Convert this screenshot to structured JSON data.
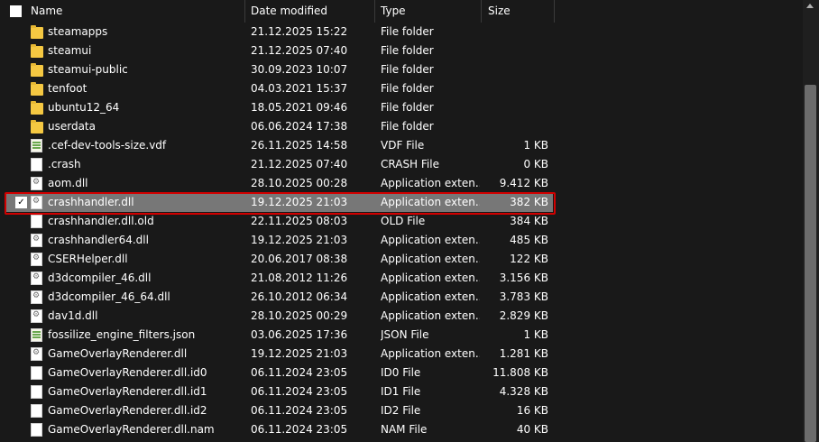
{
  "columns": {
    "name": "Name",
    "date": "Date modified",
    "type": "Type",
    "size": "Size"
  },
  "files": [
    {
      "name": "steamapps",
      "date": "21.12.2025 15:22",
      "type": "File folder",
      "size": "",
      "icon": "folder-icon"
    },
    {
      "name": "steamui",
      "date": "21.12.2025 07:40",
      "type": "File folder",
      "size": "",
      "icon": "folder-icon"
    },
    {
      "name": "steamui-public",
      "date": "30.09.2023 10:07",
      "type": "File folder",
      "size": "",
      "icon": "folder-icon"
    },
    {
      "name": "tenfoot",
      "date": "04.03.2021 15:37",
      "type": "File folder",
      "size": "",
      "icon": "folder-icon"
    },
    {
      "name": "ubuntu12_64",
      "date": "18.05.2021 09:46",
      "type": "File folder",
      "size": "",
      "icon": "folder-icon"
    },
    {
      "name": "userdata",
      "date": "06.06.2024 17:38",
      "type": "File folder",
      "size": "",
      "icon": "folder-icon"
    },
    {
      "name": ".cef-dev-tools-size.vdf",
      "date": "26.11.2025 14:58",
      "type": "VDF File",
      "size": "1 KB",
      "icon": "vdf-file-icon"
    },
    {
      "name": ".crash",
      "date": "21.12.2025 07:40",
      "type": "CRASH File",
      "size": "0 KB",
      "icon": "file-icon"
    },
    {
      "name": "aom.dll",
      "date": "28.10.2025 00:28",
      "type": "Application exten...",
      "size": "9.412 KB",
      "icon": "dll-file-icon"
    },
    {
      "name": "crashhandler.dll",
      "date": "19.12.2025 21:03",
      "type": "Application exten...",
      "size": "382 KB",
      "icon": "dll-file-icon",
      "selected": true
    },
    {
      "name": "crashhandler.dll.old",
      "date": "22.11.2025 08:03",
      "type": "OLD File",
      "size": "384 KB",
      "icon": "file-icon"
    },
    {
      "name": "crashhandler64.dll",
      "date": "19.12.2025 21:03",
      "type": "Application exten...",
      "size": "485 KB",
      "icon": "dll-file-icon"
    },
    {
      "name": "CSERHelper.dll",
      "date": "20.06.2017 08:38",
      "type": "Application exten...",
      "size": "122 KB",
      "icon": "dll-file-icon"
    },
    {
      "name": "d3dcompiler_46.dll",
      "date": "21.08.2012 11:26",
      "type": "Application exten...",
      "size": "3.156 KB",
      "icon": "dll-file-icon"
    },
    {
      "name": "d3dcompiler_46_64.dll",
      "date": "26.10.2012 06:34",
      "type": "Application exten...",
      "size": "3.783 KB",
      "icon": "dll-file-icon"
    },
    {
      "name": "dav1d.dll",
      "date": "28.10.2025 00:29",
      "type": "Application exten...",
      "size": "2.829 KB",
      "icon": "dll-file-icon"
    },
    {
      "name": "fossilize_engine_filters.json",
      "date": "03.06.2025 17:36",
      "type": "JSON File",
      "size": "1 KB",
      "icon": "vdf-file-icon"
    },
    {
      "name": "GameOverlayRenderer.dll",
      "date": "19.12.2025 21:03",
      "type": "Application exten...",
      "size": "1.281 KB",
      "icon": "dll-file-icon"
    },
    {
      "name": "GameOverlayRenderer.dll.id0",
      "date": "06.11.2024 23:05",
      "type": "ID0 File",
      "size": "11.808 KB",
      "icon": "file-icon"
    },
    {
      "name": "GameOverlayRenderer.dll.id1",
      "date": "06.11.2024 23:05",
      "type": "ID1 File",
      "size": "4.328 KB",
      "icon": "file-icon"
    },
    {
      "name": "GameOverlayRenderer.dll.id2",
      "date": "06.11.2024 23:05",
      "type": "ID2 File",
      "size": "16 KB",
      "icon": "file-icon"
    },
    {
      "name": "GameOverlayRenderer.dll.nam",
      "date": "06.11.2024 23:05",
      "type": "NAM File",
      "size": "40 KB",
      "icon": "file-icon"
    }
  ],
  "colors": {
    "background": "#191919",
    "selection": "#777777",
    "highlight_outline": "#d10000",
    "folder": "#f5c842"
  }
}
